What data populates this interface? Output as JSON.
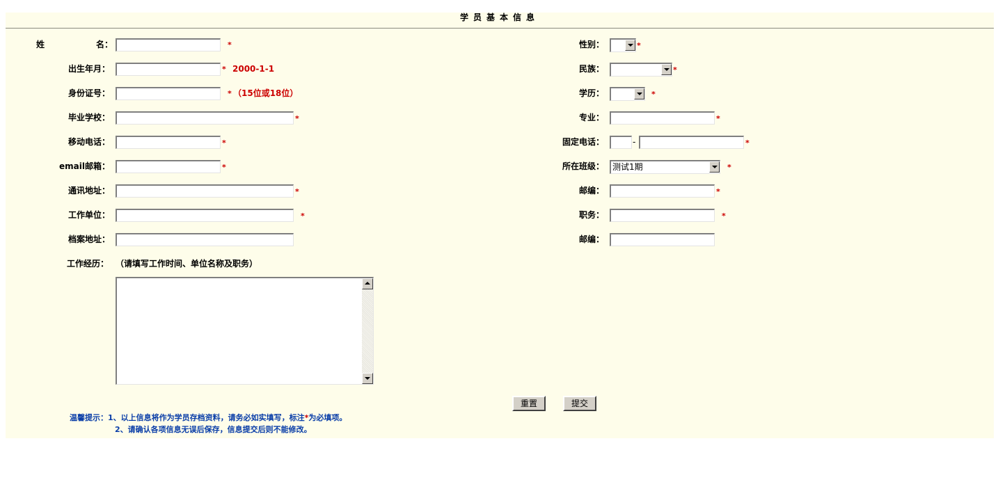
{
  "title": "学员基本信息",
  "left_fields": [
    {
      "label_a": "姓",
      "label_b": "名：",
      "required": "*"
    },
    {
      "label": "出生年月：",
      "required": "*",
      "hint": "2000-1-1"
    },
    {
      "label": "身份证号：",
      "required": "*",
      "hint": "（15位或18位）"
    },
    {
      "label": "毕业学校：",
      "required": "*"
    },
    {
      "label": "移动电话：",
      "required": "*"
    },
    {
      "label": "email邮箱：",
      "required": "*"
    },
    {
      "label": "通讯地址：",
      "required": "*"
    },
    {
      "label": "工作单位：",
      "required": "*"
    },
    {
      "label": "档案地址："
    }
  ],
  "right_fields": [
    {
      "label": "性别：",
      "required": "*",
      "value": ""
    },
    {
      "label": "民族：",
      "required": "*",
      "value": ""
    },
    {
      "label": "学历：",
      "required": "*",
      "value": ""
    },
    {
      "label": "专业：",
      "required": "*"
    },
    {
      "label": "固定电话：",
      "required": "*",
      "separator": "-"
    },
    {
      "label": "所在班级：",
      "required": "*",
      "value": "测试1期"
    },
    {
      "label": "邮编：",
      "required": "*"
    },
    {
      "label": "职务：",
      "required": "*"
    },
    {
      "label": "邮编："
    }
  ],
  "work_history": {
    "label": "工作经历：",
    "note": "（请填写工作时间、单位名称及职务）"
  },
  "buttons": {
    "reset": "重置",
    "submit": "提交"
  },
  "tips": {
    "prefix": "温馨提示：",
    "line1_a": "1、以上信息将作为学员存档资料，请务必如实填写，标注",
    "line1_star": "*",
    "line1_b": "为必填项。",
    "line2": "2、请确认各项信息无误后保存，信息提交后则不能修改。"
  },
  "colors": {
    "panel_bg": "#fefdea",
    "required": "#cc0000",
    "tip": "#0a3ea8"
  }
}
